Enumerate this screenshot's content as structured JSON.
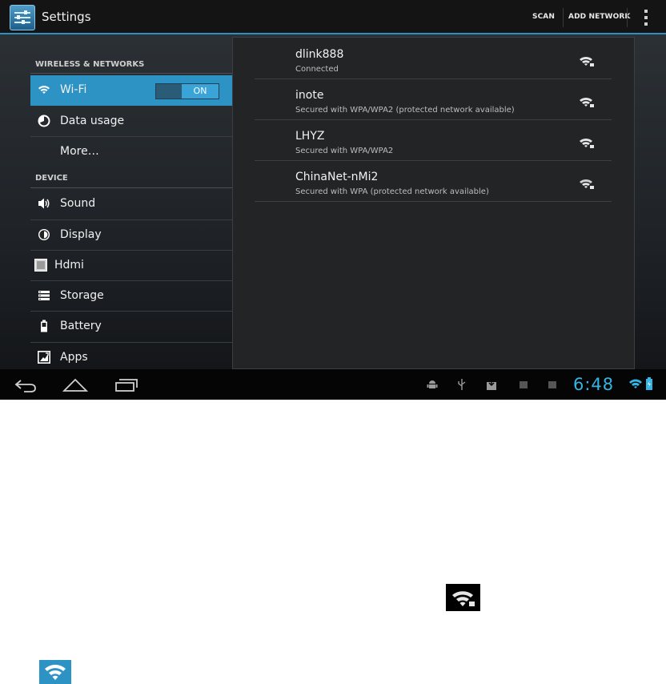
{
  "actionbar": {
    "title": "Settings",
    "scan_label": "SCAN",
    "add_network_label": "ADD NETWORK"
  },
  "left_panel": {
    "wireless_header": "WIRELESS & NETWORKS",
    "device_header": "DEVICE",
    "items": [
      {
        "label": "Wi-Fi",
        "icon": "wifi-icon"
      },
      {
        "label": "Data usage",
        "icon": "data-usage-icon"
      },
      {
        "label": "More…",
        "icon": ""
      },
      {
        "label": "Sound",
        "icon": "speaker-icon"
      },
      {
        "label": "Display",
        "icon": "brightness-icon"
      },
      {
        "label": "Hdmi",
        "icon": "hdmi-icon"
      },
      {
        "label": "Storage",
        "icon": "storage-icon"
      },
      {
        "label": "Battery",
        "icon": "battery-icon"
      },
      {
        "label": "Apps",
        "icon": "apps-icon"
      }
    ],
    "wifi_toggle": "ON"
  },
  "networks": [
    {
      "ssid": "dlink888",
      "status": "Connected"
    },
    {
      "ssid": "inote",
      "status": "Secured with WPA/WPA2 (protected network available)"
    },
    {
      "ssid": "LHYZ",
      "status": "Secured with WPA/WPA2"
    },
    {
      "ssid": "ChinaNet-nMi2",
      "status": "Secured with WPA (protected network available)"
    }
  ],
  "statusbar": {
    "time": "6:48"
  },
  "colors": {
    "accent": "#33b5e5",
    "selected": "#2d93c4"
  }
}
